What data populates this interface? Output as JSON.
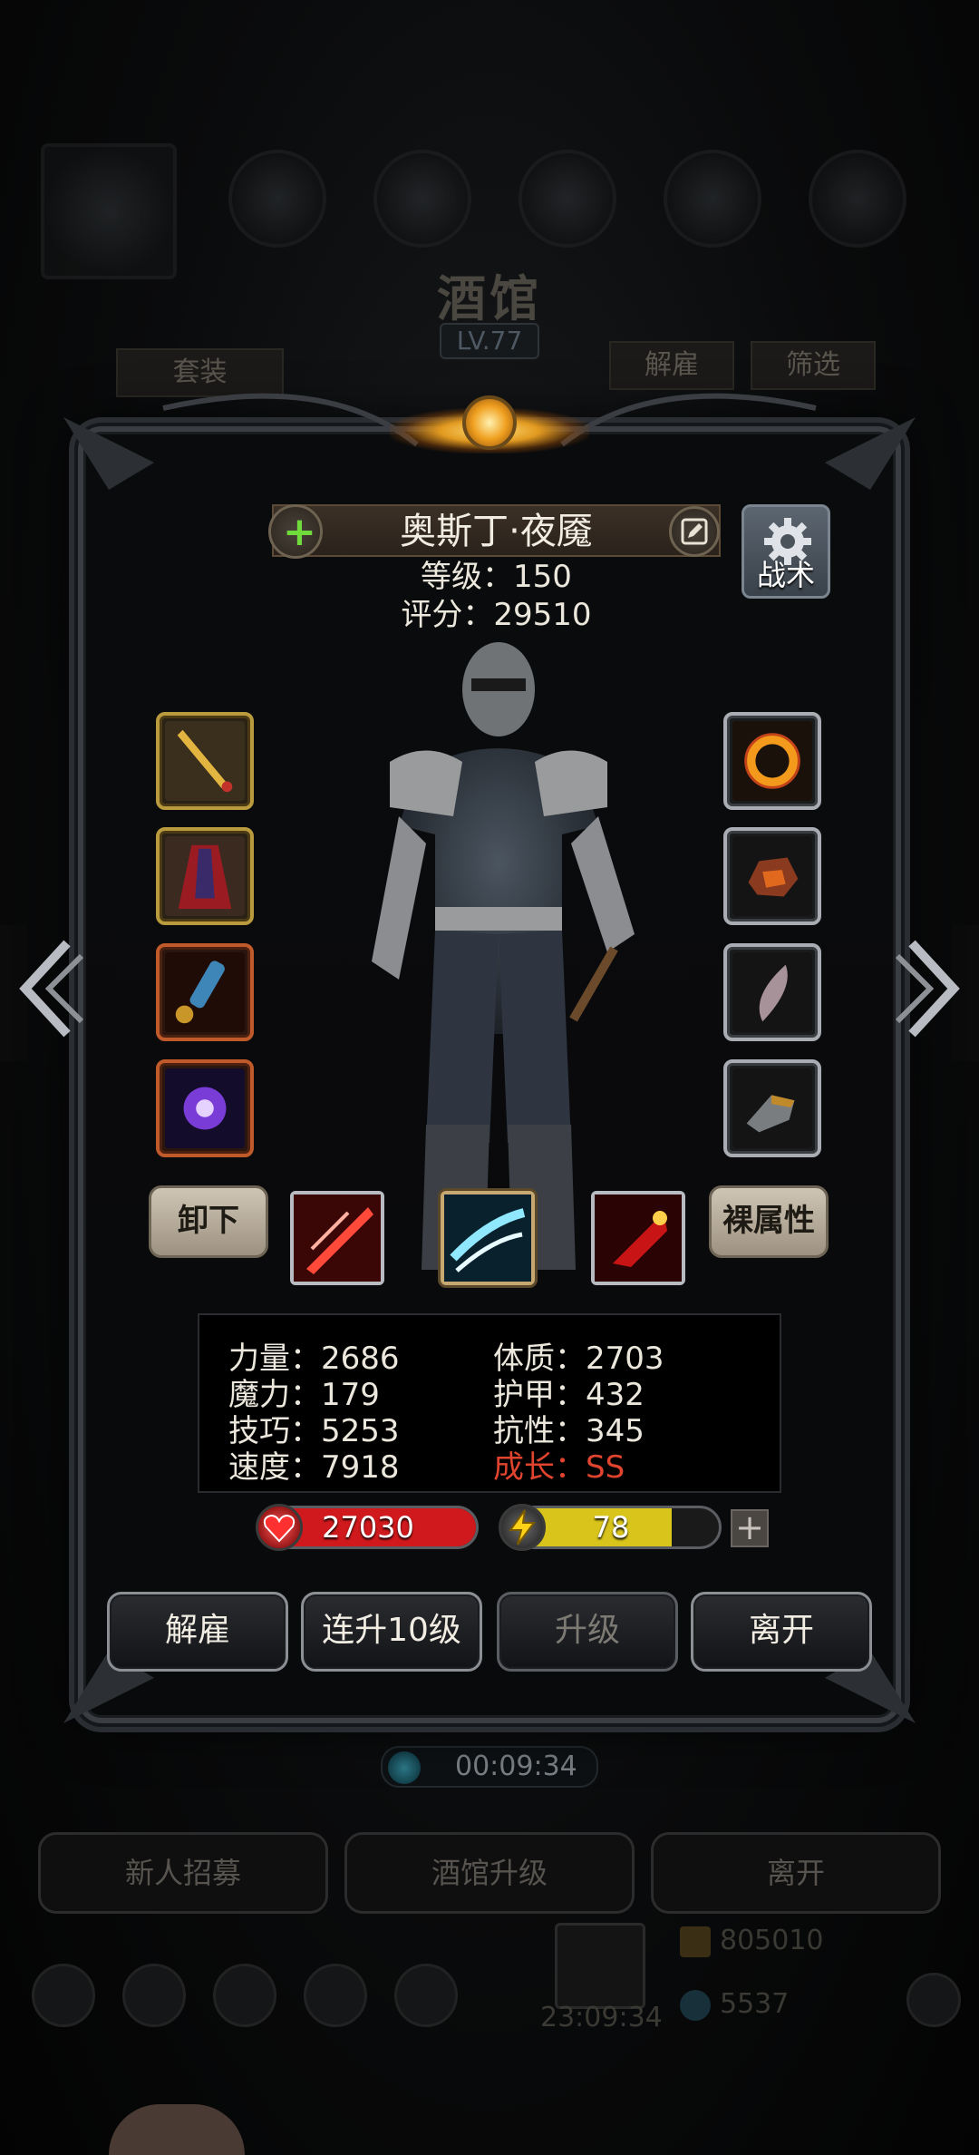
{
  "background": {
    "tavern_title": "酒馆",
    "tavern_level": "LV.77",
    "set_label": "套装",
    "dismiss_label": "解雇",
    "filter_label": "筛选",
    "timer": "00:09:34",
    "bottom_buttons": [
      "新人招募",
      "酒馆升级",
      "离开"
    ],
    "gold_amount": "805010",
    "gem_amount": "5537",
    "bottom_clock": "23:09:34"
  },
  "hero": {
    "name": "奥斯丁·夜魇",
    "level_line": "等级：150",
    "score_line": "评分：29510",
    "tactics_label": "战术"
  },
  "equipment": {
    "left": [
      "golden-dagger",
      "crimson-cloak",
      "blue-scroll",
      "purple-rune-orb"
    ],
    "right": [
      "fire-ring",
      "lava-stone",
      "feather-charm",
      "iron-gauntlet"
    ]
  },
  "skill_row": {
    "unequip_label": "卸下",
    "base_attr_label": "裸属性",
    "skills": [
      "red-slash-skill",
      "ice-slash-skill",
      "blood-strike-skill"
    ]
  },
  "stats": {
    "strength": "力量：2686",
    "magic": "魔力：179",
    "skill": "技巧：5253",
    "speed": "速度：7918",
    "constitution": "体质：2703",
    "armor": "护甲：432",
    "resistance": "抗性：345",
    "growth": "成长：SS"
  },
  "bars": {
    "hp_value": "27030",
    "hp_fill": 1.0,
    "energy_value": "78",
    "energy_fill": 0.78,
    "hp_color": "#d0191c",
    "energy_color": "#d8c41a"
  },
  "actions": {
    "dismiss": "解雇",
    "level_up_10": "连升10级",
    "level_up": "升级",
    "leave": "离开"
  }
}
